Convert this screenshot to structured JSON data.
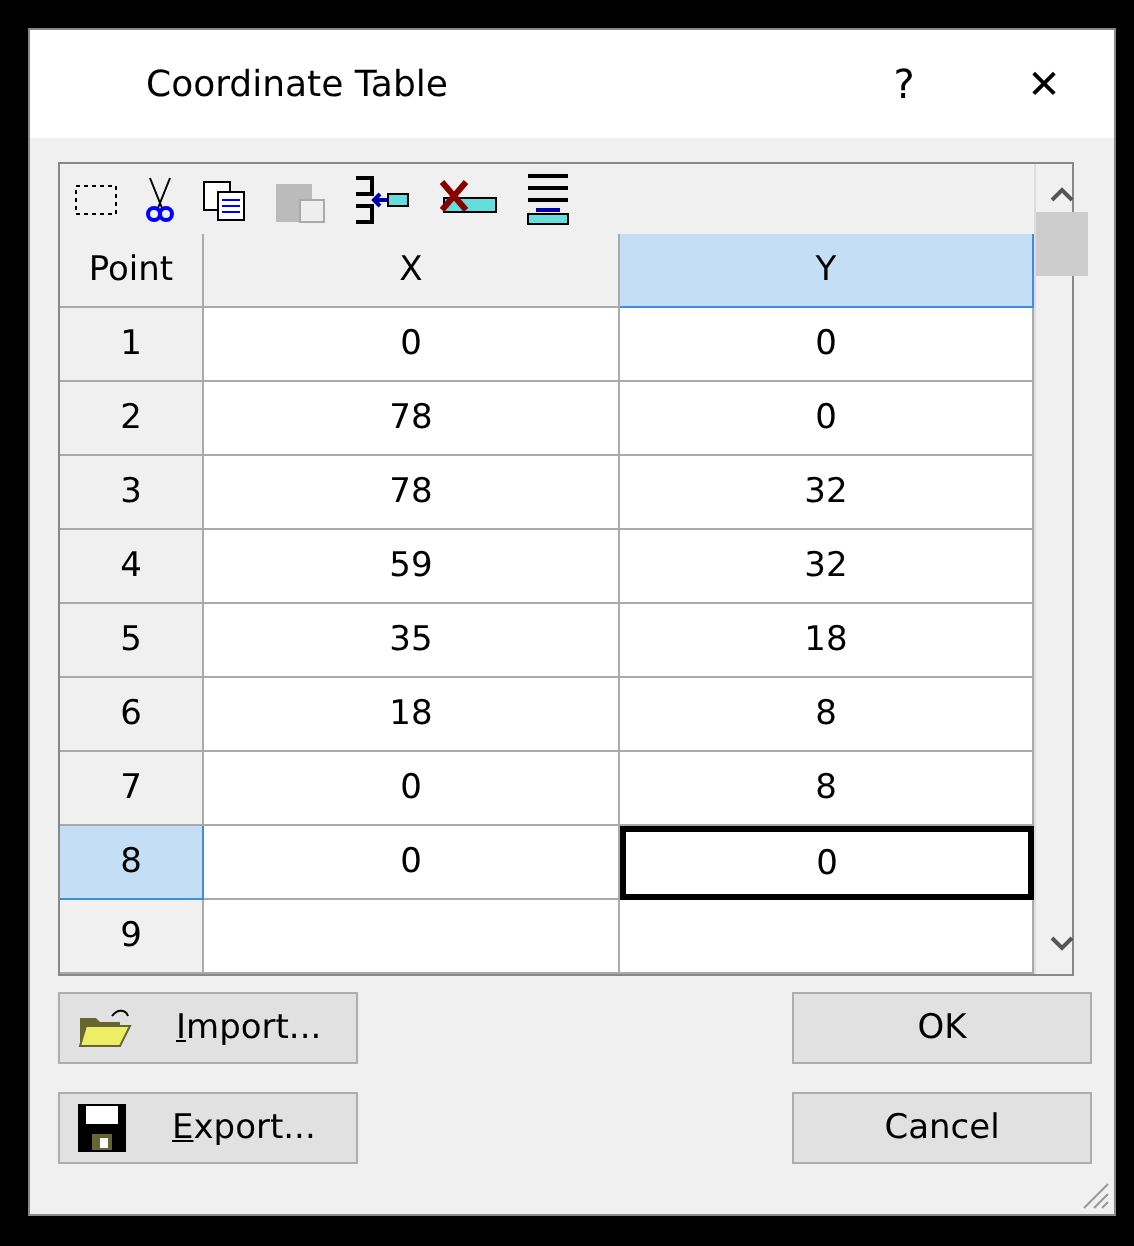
{
  "window": {
    "title": "Coordinate Table",
    "help": "?",
    "close": "✕"
  },
  "toolbar": [
    {
      "kind": "select",
      "disabled": false
    },
    {
      "kind": "cut",
      "disabled": false
    },
    {
      "kind": "copy",
      "disabled": false
    },
    {
      "kind": "paste",
      "disabled": true
    },
    {
      "kind": "insert",
      "disabled": false
    },
    {
      "kind": "delete",
      "disabled": false
    },
    {
      "kind": "append",
      "disabled": false
    }
  ],
  "table": {
    "columns": [
      {
        "label": "Point",
        "selected": false
      },
      {
        "label": "X",
        "selected": false
      },
      {
        "label": "Y",
        "selected": true
      }
    ],
    "rows": [
      {
        "cells": [
          {
            "text": "1",
            "selected": false
          },
          {
            "text": "0",
            "focused": false
          },
          {
            "text": "0",
            "focused": false
          }
        ]
      },
      {
        "cells": [
          {
            "text": "2",
            "selected": false
          },
          {
            "text": "78",
            "focused": false
          },
          {
            "text": "0",
            "focused": false
          }
        ]
      },
      {
        "cells": [
          {
            "text": "3",
            "selected": false
          },
          {
            "text": "78",
            "focused": false
          },
          {
            "text": "32",
            "focused": false
          }
        ]
      },
      {
        "cells": [
          {
            "text": "4",
            "selected": false
          },
          {
            "text": "59",
            "focused": false
          },
          {
            "text": "32",
            "focused": false
          }
        ]
      },
      {
        "cells": [
          {
            "text": "5",
            "selected": false
          },
          {
            "text": "35",
            "focused": false
          },
          {
            "text": "18",
            "focused": false
          }
        ]
      },
      {
        "cells": [
          {
            "text": "6",
            "selected": false
          },
          {
            "text": "18",
            "focused": false
          },
          {
            "text": "8",
            "focused": false
          }
        ]
      },
      {
        "cells": [
          {
            "text": "7",
            "selected": false
          },
          {
            "text": "0",
            "focused": false
          },
          {
            "text": "8",
            "focused": false
          }
        ]
      },
      {
        "cells": [
          {
            "text": "8",
            "selected": true
          },
          {
            "text": "0",
            "focused": false
          },
          {
            "text": "0",
            "focused": true
          }
        ]
      },
      {
        "cells": [
          {
            "text": "9",
            "selected": false
          },
          {
            "text": "",
            "focused": false
          },
          {
            "text": "",
            "focused": false
          }
        ]
      }
    ]
  },
  "buttons": [
    {
      "kind": "import",
      "label": "Import...",
      "mnemonic_underlined": true
    },
    {
      "kind": "ok",
      "label": "OK",
      "mnemonic_underlined": false
    },
    {
      "kind": "export",
      "label": "Export...",
      "mnemonic_underlined": true
    },
    {
      "kind": "cancel",
      "label": "Cancel",
      "mnemonic_underlined": false
    }
  ]
}
